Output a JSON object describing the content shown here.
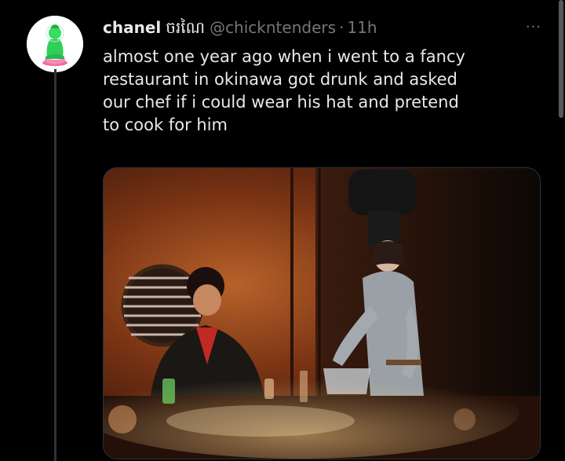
{
  "tweet": {
    "author_name": "chanel",
    "author_name_extra": "ចរណៃ",
    "handle": "@chickntenders",
    "separator": "·",
    "time": "11h",
    "more_label": "···",
    "text_lines": [
      "almost one year ago when i went to a fancy",
      "restaurant in okinawa got drunk and asked",
      "our chef if i could wear his hat and pretend",
      "to cook for him"
    ]
  },
  "avatar": {
    "icon": "buddha-statue-icon"
  },
  "photo": {
    "icon": "photo-chef-hat-restaurant"
  },
  "colors": {
    "background": "#000000",
    "text_primary": "#e7e9ea",
    "text_secondary": "#71767b",
    "border": "#2f3336"
  }
}
